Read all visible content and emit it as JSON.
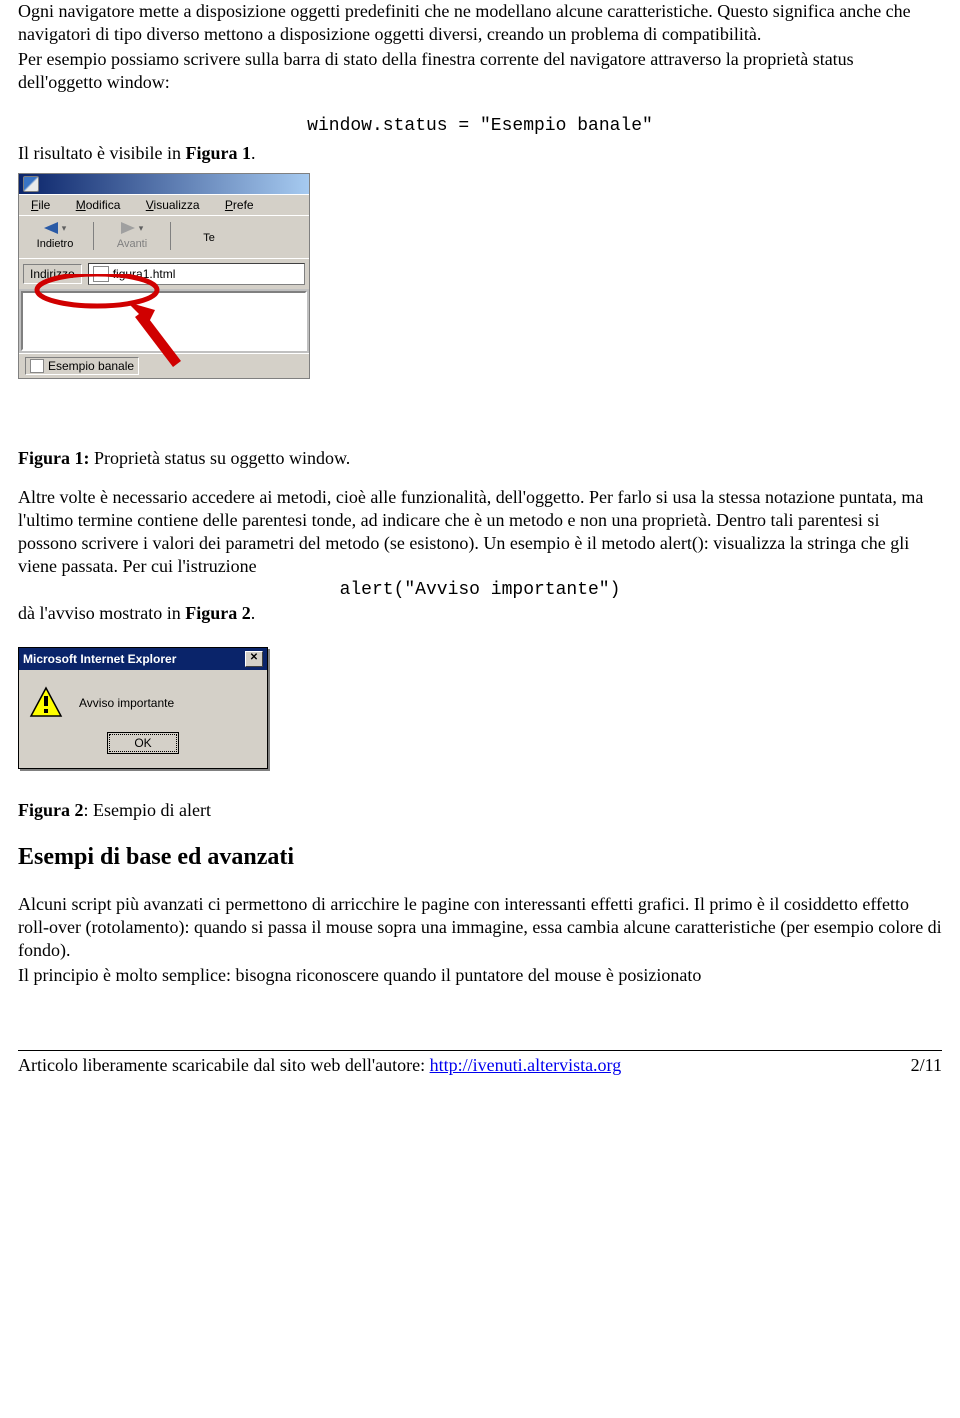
{
  "para1": "Ogni navigatore mette a disposizione oggetti predefiniti che ne modellano alcune caratteristiche. Questo significa anche che navigatori di tipo diverso mettono a disposizione oggetti diversi, creando un problema di compatibilità.",
  "para1b": "Per esempio possiamo scrivere sulla barra di stato della finestra corrente del navigatore attraverso la proprietà status dell'oggetto window:",
  "code1": "window.status = \"Esempio banale\"",
  "para2_a": "Il risultato è visibile in ",
  "para2_b": "Figura 1",
  "para2_c": ".",
  "fig1": {
    "menu": {
      "file": "File",
      "modifica": "Modifica",
      "visualizza": "Visualizza",
      "pref": "Prefe"
    },
    "toolbar": {
      "back": "Indietro",
      "forward": "Avanti",
      "third": "Te"
    },
    "addr_label": "Indirizzo",
    "addr_value": "figura1.html",
    "status_text": "Esempio banale"
  },
  "caption1_a": "Figura 1:",
  "caption1_b": " Proprietà status su oggetto window.",
  "para3": " Altre volte è necessario accedere ai metodi, cioè alle funzionalità, dell'oggetto. Per farlo si usa la stessa notazione puntata, ma l'ultimo termine contiene delle parentesi tonde, ad indicare che è un metodo e non una proprietà. Dentro tali parentesi si possono scrivere i valori dei parametri del metodo (se esistono). Un esempio è il metodo alert(): visualizza la stringa che gli viene passata. Per cui l'istruzione",
  "code2": "alert(\"Avviso importante\")",
  "para4_a": "dà l'avviso mostrato in ",
  "para4_b": "Figura 2",
  "para4_c": ".",
  "fig2": {
    "title": "Microsoft Internet Explorer",
    "message": "Avviso importante",
    "ok": "OK"
  },
  "caption2_a": "Figura 2",
  "caption2_b": ": Esempio di alert",
  "heading": "Esempi di base ed avanzati",
  "para5": "Alcuni script più avanzati ci permettono di arricchire le pagine con interessanti effetti grafici. Il primo è il cosiddetto effetto roll-over (rotolamento): quando si passa il mouse sopra una immagine, essa cambia alcune caratteristiche (per esempio colore di fondo).",
  "para5b": "Il principio è molto semplice: bisogna riconoscere quando il puntatore del mouse è posizionato",
  "footer": {
    "text_a": "Articolo liberamente scaricabile dal sito web dell'autore: ",
    "link": "http://ivenuti.altervista.org",
    "page": "2/11"
  }
}
